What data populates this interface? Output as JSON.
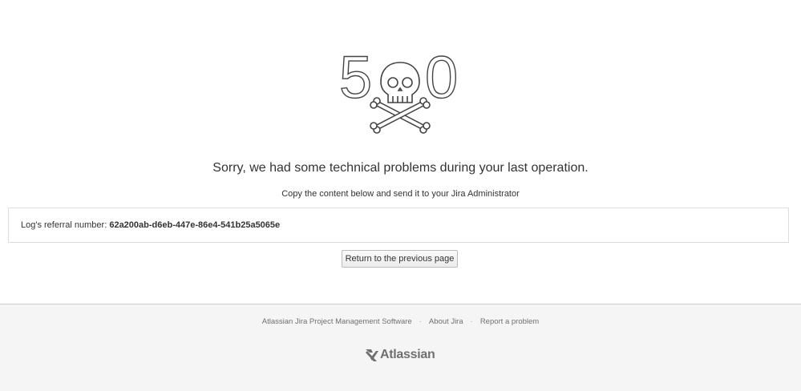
{
  "error": {
    "code_left": "5",
    "code_right": "0",
    "headline": "Sorry, we had some technical problems during your last operation.",
    "instruction": "Copy the content below and send it to your Jira Administrator",
    "log_label": "Log's referral number:",
    "log_value": "62a200ab-d6eb-447e-86e4-541b25a5065e",
    "return_button": "Return to the previous page"
  },
  "footer": {
    "links": [
      {
        "label": "Atlassian Jira Project Management Software"
      },
      {
        "label": "About Jira"
      },
      {
        "label": "Report a problem"
      }
    ],
    "separator": "·",
    "logo_text": "Atlassian"
  },
  "icons": {
    "error_graphic": "skull-crossbones-icon",
    "logo_mark": "atlassian-logo-icon"
  },
  "colors": {
    "text": "#333333",
    "footer_bg": "#f5f5f5",
    "footer_text": "#707070",
    "border": "#dddddd"
  }
}
